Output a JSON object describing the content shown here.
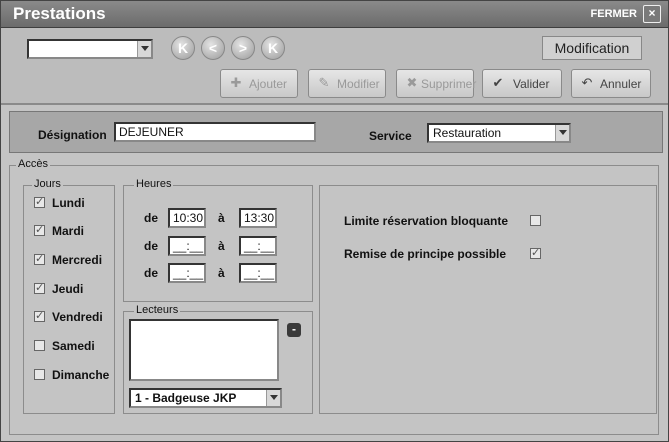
{
  "window": {
    "title": "Prestations",
    "close_label": "FERMER",
    "close_glyph": "×"
  },
  "toolbar": {
    "record_selector": "",
    "nav": {
      "first": "K",
      "prev": "<",
      "next": ">",
      "last": "K"
    },
    "mode_label": "Modification",
    "actions": {
      "add": "Ajouter",
      "edit": "Modifier",
      "delete": "Supprimer",
      "validate": "Valider",
      "cancel": "Annuler"
    }
  },
  "designation": {
    "label": "Désignation",
    "value": "DEJEUNER"
  },
  "service": {
    "label": "Service",
    "value": "Restauration"
  },
  "acces": {
    "label": "Accès"
  },
  "jours": {
    "label": "Jours",
    "items": [
      {
        "label": "Lundi",
        "checked": true
      },
      {
        "label": "Mardi",
        "checked": true
      },
      {
        "label": "Mercredi",
        "checked": true
      },
      {
        "label": "Jeudi",
        "checked": true
      },
      {
        "label": "Vendredi",
        "checked": true
      },
      {
        "label": "Samedi",
        "checked": false
      },
      {
        "label": "Dimanche",
        "checked": false
      }
    ]
  },
  "heures": {
    "label": "Heures",
    "de": "de",
    "a": "à",
    "rows": [
      {
        "from": "10:30",
        "to": "13:30"
      },
      {
        "from": "__:__",
        "to": "__:__"
      },
      {
        "from": "__:__",
        "to": "__:__"
      }
    ]
  },
  "lecteurs": {
    "label": "Lecteurs",
    "remove_glyph": "-",
    "selected": "1 - Badgeuse JKP"
  },
  "options": {
    "limite": {
      "label": "Limite réservation bloquante",
      "checked": false
    },
    "remise": {
      "label": "Remise de principe possible",
      "checked": true
    }
  }
}
